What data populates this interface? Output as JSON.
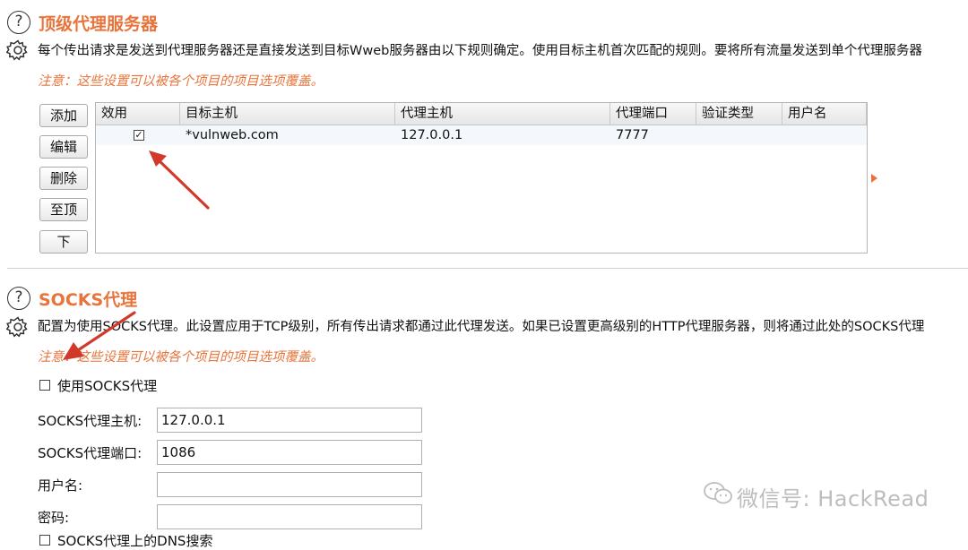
{
  "upstream": {
    "title": "顶级代理服务器",
    "description": "每个传出请求是发送到代理服务器还是直接发送到目标Wweb服务器由以下规则确定。使用目标主机首次匹配的规则。要将所有流量发送到单个代理服务器",
    "note": "注意：这些设置可以被各个项目的项目选项覆盖。",
    "buttons": {
      "add": "添加",
      "edit": "编辑",
      "remove": "删除",
      "top": "至顶",
      "down": "下"
    },
    "columns": [
      "效用",
      "目标主机",
      "代理主机",
      "代理端口",
      "验证类型",
      "用户名"
    ],
    "rows": [
      {
        "enabled": true,
        "destination_host": "*vulnweb.com",
        "proxy_host": "127.0.0.1",
        "proxy_port": "7777",
        "auth_type": "",
        "username": ""
      }
    ]
  },
  "socks": {
    "title": "SOCKS代理",
    "description": "配置为使用SOCKS代理。此设置应用于TCP级别，所有传出请求都通过此代理发送。如果已设置更高级别的HTTP代理服务器，则将通过此处的SOCKS代理",
    "note": "注意：这些设置可以被各个项目的项目选项覆盖。",
    "use_socks_label": "使用SOCKS代理",
    "use_socks_checked": false,
    "host_label": "SOCKS代理主机:",
    "host_value": "127.0.0.1",
    "port_label": "SOCKS代理端口:",
    "port_value": "1086",
    "username_label": "用户名:",
    "username_value": "",
    "password_label": "密码:",
    "password_value": "",
    "dns_label": "SOCKS代理上的DNS搜索"
  },
  "watermark": "微信号: HackRead",
  "colors": {
    "accent": "#e8743b",
    "annotation_arrow": "#d13a2a"
  }
}
